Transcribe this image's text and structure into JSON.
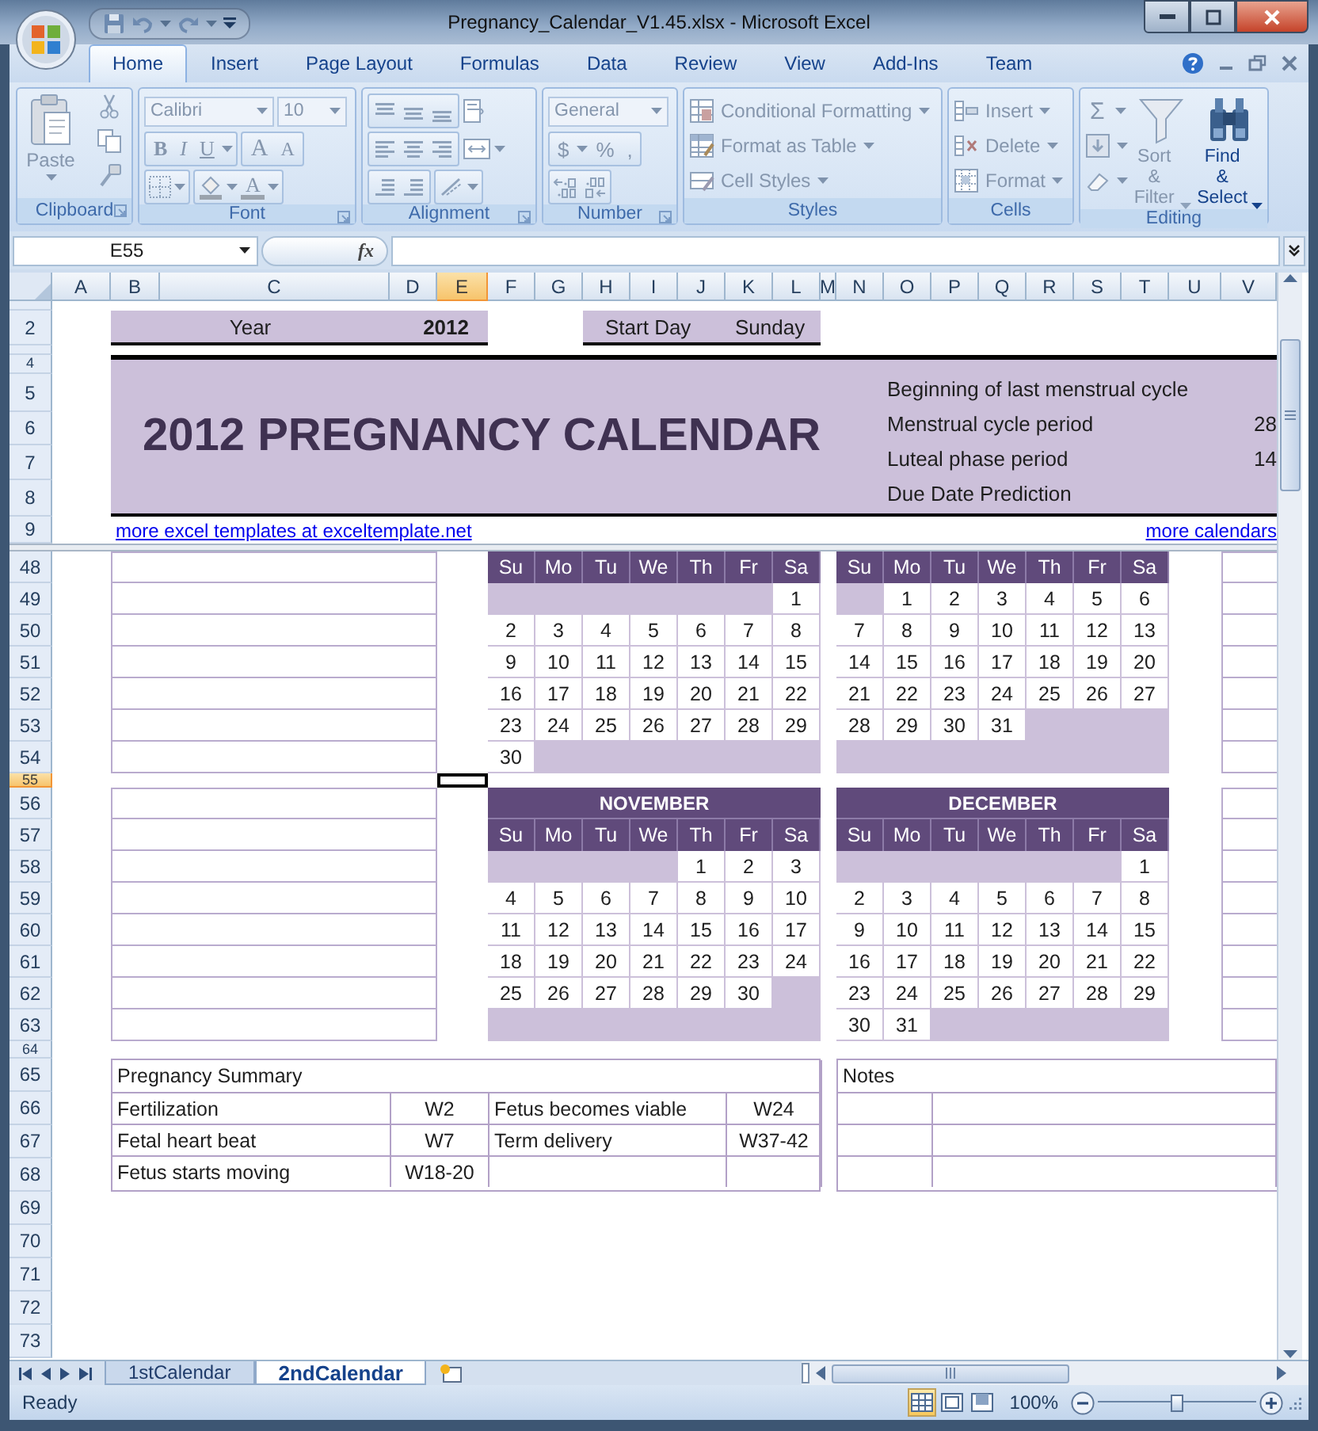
{
  "window": {
    "title": "Pregnancy_Calendar_V1.45.xlsx - Microsoft Excel"
  },
  "ribbon": {
    "tabs": [
      {
        "label": "Home",
        "selected": true
      },
      {
        "label": "Insert",
        "selected": false
      },
      {
        "label": "Page Layout",
        "selected": false
      },
      {
        "label": "Formulas",
        "selected": false
      },
      {
        "label": "Data",
        "selected": false
      },
      {
        "label": "Review",
        "selected": false
      },
      {
        "label": "View",
        "selected": false
      },
      {
        "label": "Add-Ins",
        "selected": false
      },
      {
        "label": "Team",
        "selected": false
      }
    ],
    "clipboard": {
      "label": "Clipboard",
      "paste": {
        "label": "Paste",
        "disabled": true
      }
    },
    "font": {
      "label": "Font",
      "disabled": true,
      "font_name": "Calibri",
      "font_size": "10",
      "style_buttons": [
        "B",
        "I",
        "U"
      ],
      "size_buttons": [
        "A",
        "A"
      ],
      "color_button": "A"
    },
    "alignment": {
      "label": "Alignment",
      "disabled": true
    },
    "number": {
      "label": "Number",
      "disabled": true,
      "format": "General",
      "symbol_buttons": [
        "$",
        "%",
        ","
      ]
    },
    "styles": {
      "label": "Styles",
      "commands": [
        {
          "label": "Conditional Formatting",
          "disabled": true
        },
        {
          "label": "Format as Table",
          "disabled": true
        },
        {
          "label": "Cell Styles",
          "disabled": true
        }
      ]
    },
    "cells": {
      "label": "Cells",
      "commands": [
        {
          "label": "Insert",
          "disabled": true
        },
        {
          "label": "Delete",
          "disabled": true
        },
        {
          "label": "Format",
          "disabled": true
        }
      ]
    },
    "editing": {
      "label": "Editing",
      "autosum": "Σ",
      "commands": [
        {
          "label": "Sort & Filter",
          "disabled": true
        },
        {
          "label": "Find & Select",
          "disabled": false
        }
      ]
    }
  },
  "formula_bar": {
    "name_box": "E55",
    "function_label": "fx"
  },
  "columns": [
    {
      "label": "A",
      "selected": false
    },
    {
      "label": "B",
      "selected": false
    },
    {
      "label": "C",
      "selected": false
    },
    {
      "label": "D",
      "selected": false
    },
    {
      "label": "E",
      "selected": true
    },
    {
      "label": "F",
      "selected": false
    },
    {
      "label": "G",
      "selected": false
    },
    {
      "label": "H",
      "selected": false
    },
    {
      "label": "I",
      "selected": false
    },
    {
      "label": "J",
      "selected": false
    },
    {
      "label": "K",
      "selected": false
    },
    {
      "label": "L",
      "selected": false
    },
    {
      "label": "M",
      "selected": false
    },
    {
      "label": "N",
      "selected": false
    },
    {
      "label": "O",
      "selected": false
    },
    {
      "label": "P",
      "selected": false
    },
    {
      "label": "Q",
      "selected": false
    },
    {
      "label": "R",
      "selected": false
    },
    {
      "label": "S",
      "selected": false
    },
    {
      "label": "T",
      "selected": false
    },
    {
      "label": "U",
      "selected": false
    },
    {
      "label": "V",
      "selected": false
    }
  ],
  "rows": [
    {
      "label": "2",
      "selected": false
    },
    {
      "label": "4",
      "selected": false
    },
    {
      "label": "5",
      "selected": false
    },
    {
      "label": "6",
      "selected": false
    },
    {
      "label": "7",
      "selected": false
    },
    {
      "label": "8",
      "selected": false
    },
    {
      "label": "9",
      "selected": false
    },
    {
      "label": "48",
      "selected": false
    },
    {
      "label": "49",
      "selected": false
    },
    {
      "label": "50",
      "selected": false
    },
    {
      "label": "51",
      "selected": false
    },
    {
      "label": "52",
      "selected": false
    },
    {
      "label": "53",
      "selected": false
    },
    {
      "label": "54",
      "selected": false
    },
    {
      "label": "55",
      "selected": true
    },
    {
      "label": "56",
      "selected": false
    },
    {
      "label": "57",
      "selected": false
    },
    {
      "label": "58",
      "selected": false
    },
    {
      "label": "59",
      "selected": false
    },
    {
      "label": "60",
      "selected": false
    },
    {
      "label": "61",
      "selected": false
    },
    {
      "label": "62",
      "selected": false
    },
    {
      "label": "63",
      "selected": false
    },
    {
      "label": "64",
      "selected": false
    },
    {
      "label": "65",
      "selected": false
    },
    {
      "label": "66",
      "selected": false
    },
    {
      "label": "67",
      "selected": false
    },
    {
      "label": "68",
      "selected": false
    },
    {
      "label": "69",
      "selected": false
    },
    {
      "label": "70",
      "selected": false
    },
    {
      "label": "71",
      "selected": false
    },
    {
      "label": "72",
      "selected": false
    },
    {
      "label": "73",
      "selected": false
    }
  ],
  "sheet": {
    "year": {
      "label": "Year",
      "value": "2012"
    },
    "start_day": {
      "label": "Start Day",
      "value": "Sunday"
    },
    "banner": {
      "title": "2012 PREGNANCY CALENDAR",
      "details": [
        {
          "label": "Beginning of last menstrual cycle"
        },
        {
          "label": "Menstrual cycle period",
          "value": "28"
        },
        {
          "label": "Luteal phase period",
          "value": "14"
        },
        {
          "label": "Due Date Prediction"
        }
      ]
    },
    "links": [
      "more excel templates at exceltemplate.net",
      "more calendars"
    ],
    "calendars": [
      {
        "weekdays": [
          "Su",
          "Mo",
          "Tu",
          "We",
          "Th",
          "Fr",
          "Sa"
        ],
        "weeks": [
          [
            {
              "kind": "blank"
            },
            {
              "kind": "blank"
            },
            {
              "kind": "blank"
            },
            {
              "kind": "blank"
            },
            {
              "kind": "blank"
            },
            {
              "kind": "blank"
            },
            {
              "kind": "day",
              "text": "1"
            }
          ],
          [
            {
              "kind": "day",
              "text": "2"
            },
            {
              "kind": "day",
              "text": "3"
            },
            {
              "kind": "day",
              "text": "4"
            },
            {
              "kind": "day",
              "text": "5"
            },
            {
              "kind": "day",
              "text": "6"
            },
            {
              "kind": "day",
              "text": "7"
            },
            {
              "kind": "day",
              "text": "8"
            }
          ],
          [
            {
              "kind": "day",
              "text": "9"
            },
            {
              "kind": "day",
              "text": "10"
            },
            {
              "kind": "day",
              "text": "11"
            },
            {
              "kind": "day",
              "text": "12"
            },
            {
              "kind": "day",
              "text": "13"
            },
            {
              "kind": "day",
              "text": "14"
            },
            {
              "kind": "day",
              "text": "15"
            }
          ],
          [
            {
              "kind": "day",
              "text": "16"
            },
            {
              "kind": "day",
              "text": "17"
            },
            {
              "kind": "day",
              "text": "18"
            },
            {
              "kind": "day",
              "text": "19"
            },
            {
              "kind": "day",
              "text": "20"
            },
            {
              "kind": "day",
              "text": "21"
            },
            {
              "kind": "day",
              "text": "22"
            }
          ],
          [
            {
              "kind": "day",
              "text": "23"
            },
            {
              "kind": "day",
              "text": "24"
            },
            {
              "kind": "day",
              "text": "25"
            },
            {
              "kind": "day",
              "text": "26"
            },
            {
              "kind": "day",
              "text": "27"
            },
            {
              "kind": "day",
              "text": "28"
            },
            {
              "kind": "day",
              "text": "29"
            }
          ],
          [
            {
              "kind": "day",
              "text": "30"
            },
            {
              "kind": "blank"
            },
            {
              "kind": "blank"
            },
            {
              "kind": "blank"
            },
            {
              "kind": "blank"
            },
            {
              "kind": "blank"
            },
            {
              "kind": "blank"
            }
          ]
        ]
      },
      {
        "weekdays": [
          "Su",
          "Mo",
          "Tu",
          "We",
          "Th",
          "Fr",
          "Sa"
        ],
        "weeks": [
          [
            {
              "kind": "blank"
            },
            {
              "kind": "day",
              "text": "1"
            },
            {
              "kind": "day",
              "text": "2"
            },
            {
              "kind": "day",
              "text": "3"
            },
            {
              "kind": "day",
              "text": "4"
            },
            {
              "kind": "day",
              "text": "5"
            },
            {
              "kind": "day",
              "text": "6"
            }
          ],
          [
            {
              "kind": "day",
              "text": "7"
            },
            {
              "kind": "day",
              "text": "8"
            },
            {
              "kind": "day",
              "text": "9"
            },
            {
              "kind": "day",
              "text": "10"
            },
            {
              "kind": "day",
              "text": "11"
            },
            {
              "kind": "day",
              "text": "12"
            },
            {
              "kind": "day",
              "text": "13"
            }
          ],
          [
            {
              "kind": "day",
              "text": "14"
            },
            {
              "kind": "day",
              "text": "15"
            },
            {
              "kind": "day",
              "text": "16"
            },
            {
              "kind": "day",
              "text": "17"
            },
            {
              "kind": "day",
              "text": "18"
            },
            {
              "kind": "day",
              "text": "19"
            },
            {
              "kind": "day",
              "text": "20"
            }
          ],
          [
            {
              "kind": "day",
              "text": "21"
            },
            {
              "kind": "day",
              "text": "22"
            },
            {
              "kind": "day",
              "text": "23"
            },
            {
              "kind": "day",
              "text": "24"
            },
            {
              "kind": "day",
              "text": "25"
            },
            {
              "kind": "day",
              "text": "26"
            },
            {
              "kind": "day",
              "text": "27"
            }
          ],
          [
            {
              "kind": "day",
              "text": "28"
            },
            {
              "kind": "day",
              "text": "29"
            },
            {
              "kind": "day",
              "text": "30"
            },
            {
              "kind": "day",
              "text": "31"
            },
            {
              "kind": "blank"
            },
            {
              "kind": "blank"
            },
            {
              "kind": "blank"
            }
          ],
          [
            {
              "kind": "blank"
            },
            {
              "kind": "blank"
            },
            {
              "kind": "blank"
            },
            {
              "kind": "blank"
            },
            {
              "kind": "blank"
            },
            {
              "kind": "blank"
            },
            {
              "kind": "blank"
            }
          ]
        ]
      },
      {
        "title": "NOVEMBER",
        "weekdays": [
          "Su",
          "Mo",
          "Tu",
          "We",
          "Th",
          "Fr",
          "Sa"
        ],
        "weeks": [
          [
            {
              "kind": "blank"
            },
            {
              "kind": "blank"
            },
            {
              "kind": "blank"
            },
            {
              "kind": "blank"
            },
            {
              "kind": "day",
              "text": "1"
            },
            {
              "kind": "day",
              "text": "2"
            },
            {
              "kind": "day",
              "text": "3"
            }
          ],
          [
            {
              "kind": "day",
              "text": "4"
            },
            {
              "kind": "day",
              "text": "5"
            },
            {
              "kind": "day",
              "text": "6"
            },
            {
              "kind": "day",
              "text": "7"
            },
            {
              "kind": "day",
              "text": "8"
            },
            {
              "kind": "day",
              "text": "9"
            },
            {
              "kind": "day",
              "text": "10"
            }
          ],
          [
            {
              "kind": "day",
              "text": "11"
            },
            {
              "kind": "day",
              "text": "12"
            },
            {
              "kind": "day",
              "text": "13"
            },
            {
              "kind": "day",
              "text": "14"
            },
            {
              "kind": "day",
              "text": "15"
            },
            {
              "kind": "day",
              "text": "16"
            },
            {
              "kind": "day",
              "text": "17"
            }
          ],
          [
            {
              "kind": "day",
              "text": "18"
            },
            {
              "kind": "day",
              "text": "19"
            },
            {
              "kind": "day",
              "text": "20"
            },
            {
              "kind": "day",
              "text": "21"
            },
            {
              "kind": "day",
              "text": "22"
            },
            {
              "kind": "day",
              "text": "23"
            },
            {
              "kind": "day",
              "text": "24"
            }
          ],
          [
            {
              "kind": "day",
              "text": "25"
            },
            {
              "kind": "day",
              "text": "26"
            },
            {
              "kind": "day",
              "text": "27"
            },
            {
              "kind": "day",
              "text": "28"
            },
            {
              "kind": "day",
              "text": "29"
            },
            {
              "kind": "day",
              "text": "30"
            },
            {
              "kind": "blank"
            }
          ],
          [
            {
              "kind": "blank"
            },
            {
              "kind": "blank"
            },
            {
              "kind": "blank"
            },
            {
              "kind": "blank"
            },
            {
              "kind": "blank"
            },
            {
              "kind": "blank"
            },
            {
              "kind": "blank"
            }
          ]
        ]
      },
      {
        "title": "DECEMBER",
        "weekdays": [
          "Su",
          "Mo",
          "Tu",
          "We",
          "Th",
          "Fr",
          "Sa"
        ],
        "weeks": [
          [
            {
              "kind": "blank"
            },
            {
              "kind": "blank"
            },
            {
              "kind": "blank"
            },
            {
              "kind": "blank"
            },
            {
              "kind": "blank"
            },
            {
              "kind": "blank"
            },
            {
              "kind": "day",
              "text": "1"
            }
          ],
          [
            {
              "kind": "day",
              "text": "2"
            },
            {
              "kind": "day",
              "text": "3"
            },
            {
              "kind": "day",
              "text": "4"
            },
            {
              "kind": "day",
              "text": "5"
            },
            {
              "kind": "day",
              "text": "6"
            },
            {
              "kind": "day",
              "text": "7"
            },
            {
              "kind": "day",
              "text": "8"
            }
          ],
          [
            {
              "kind": "day",
              "text": "9"
            },
            {
              "kind": "day",
              "text": "10"
            },
            {
              "kind": "day",
              "text": "11"
            },
            {
              "kind": "day",
              "text": "12"
            },
            {
              "kind": "day",
              "text": "13"
            },
            {
              "kind": "day",
              "text": "14"
            },
            {
              "kind": "day",
              "text": "15"
            }
          ],
          [
            {
              "kind": "day",
              "text": "16"
            },
            {
              "kind": "day",
              "text": "17"
            },
            {
              "kind": "day",
              "text": "18"
            },
            {
              "kind": "day",
              "text": "19"
            },
            {
              "kind": "day",
              "text": "20"
            },
            {
              "kind": "day",
              "text": "21"
            },
            {
              "kind": "day",
              "text": "22"
            }
          ],
          [
            {
              "kind": "day",
              "text": "23"
            },
            {
              "kind": "day",
              "text": "24"
            },
            {
              "kind": "day",
              "text": "25"
            },
            {
              "kind": "day",
              "text": "26"
            },
            {
              "kind": "day",
              "text": "27"
            },
            {
              "kind": "day",
              "text": "28"
            },
            {
              "kind": "day",
              "text": "29"
            }
          ],
          [
            {
              "kind": "day",
              "text": "30"
            },
            {
              "kind": "day",
              "text": "31"
            },
            {
              "kind": "blank"
            },
            {
              "kind": "blank"
            },
            {
              "kind": "blank"
            },
            {
              "kind": "blank"
            },
            {
              "kind": "blank"
            }
          ]
        ]
      }
    ],
    "summary": {
      "title": "Pregnancy Summary",
      "rows": [
        [
          "Fertilization",
          "W2",
          "Fetus becomes viable",
          "W24"
        ],
        [
          "Fetal heart beat",
          "W7",
          "Term delivery",
          "W37-42"
        ],
        [
          "Fetus starts moving",
          "W18-20"
        ]
      ]
    },
    "notes": {
      "title": "Notes"
    }
  },
  "sheet_tabs": [
    {
      "label": "1stCalendar",
      "selected": false
    },
    {
      "label": "2ndCalendar",
      "selected": true
    }
  ],
  "status_bar": {
    "text": "Ready",
    "views": [
      {
        "kind": "normal",
        "selected": true
      },
      {
        "kind": "page_layout",
        "selected": false
      },
      {
        "kind": "page_break",
        "selected": false
      }
    ],
    "zoom": "100%",
    "zoom_slider": {
      "level": 0.5
    }
  }
}
